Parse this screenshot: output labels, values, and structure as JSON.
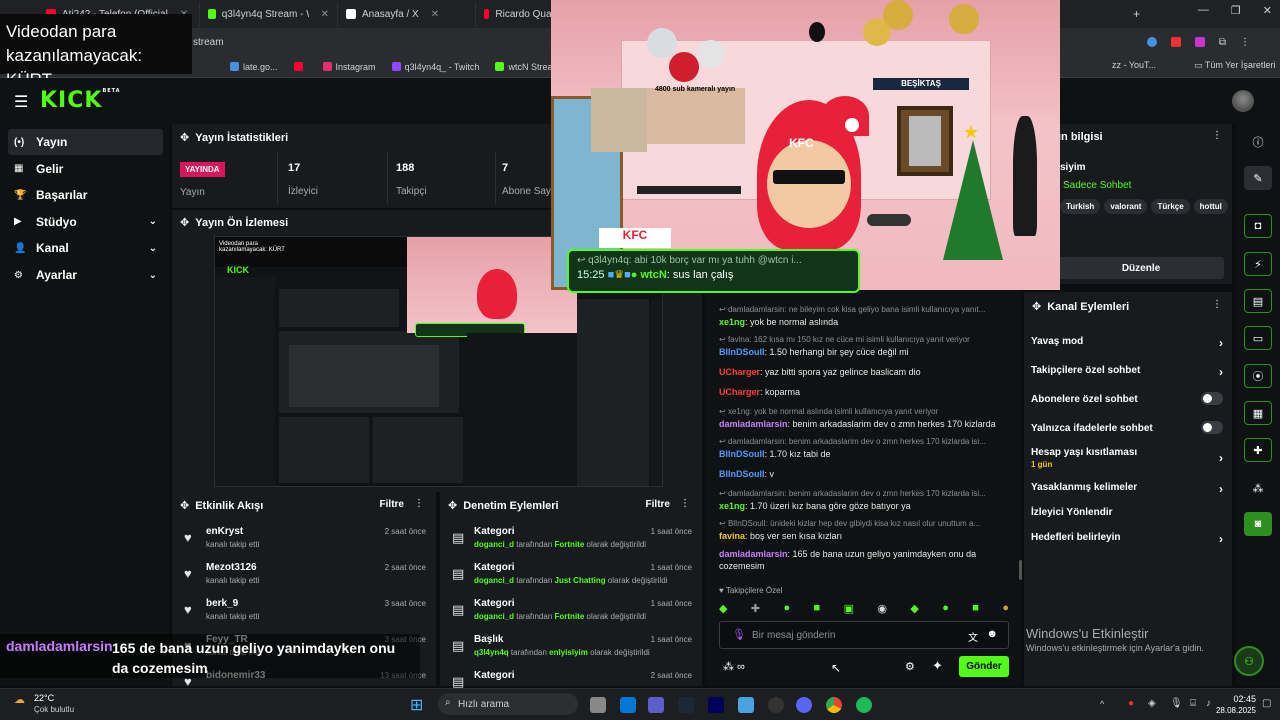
{
  "browser": {
    "tabs": [
      {
        "label": "Ati242 - Telefon (Official",
        "color": "#ff0033"
      },
      {
        "label": "q3l4yn4q Stream - Watch",
        "color": "#53fc18"
      },
      {
        "label": "Anasayfa / X",
        "color": "#ffffff"
      },
      {
        "label": "Ricardo Quaresma • Çing",
        "color": "#ff0033"
      }
    ],
    "address": "stream",
    "bookmarks": [
      {
        "label": "late.go...",
        "color": "#4a90e2"
      },
      {
        "label": "",
        "color": "#ff0033"
      },
      {
        "label": "Instagram",
        "color": "#e1306c"
      },
      {
        "label": "q3l4yn4q_ - Twitch",
        "color": "#9146ff"
      },
      {
        "label": "wtcN Stream - Watc...",
        "color": "#53fc18"
      },
      {
        "label": "Sana c",
        "color": "#ffffff"
      }
    ],
    "bookmarks_right": [
      "zz - YouT...",
      "Tüm Yer İşaretleri"
    ]
  },
  "overlay_title": {
    "line1": "Videodan para",
    "line2": "kazanılamayacak: KÜRT"
  },
  "header": {
    "logo": "KICK",
    "logo_sup": "BETA"
  },
  "nav": [
    {
      "label": "Yayın",
      "icon": "(•)",
      "chevron": false,
      "active": true
    },
    {
      "label": "Gelir",
      "icon": "▦",
      "chevron": false,
      "active": false
    },
    {
      "label": "Başarılar",
      "icon": "🏆",
      "chevron": false,
      "active": false
    },
    {
      "label": "Stüdyo",
      "icon": "▶",
      "chevron": true,
      "active": false
    },
    {
      "label": "Kanal",
      "icon": "👤",
      "chevron": true,
      "active": false
    },
    {
      "label": "Ayarlar",
      "icon": "⚙",
      "chevron": true,
      "active": false
    }
  ],
  "stats": {
    "title": "Yayın İstatistikleri",
    "live_badge": "YAYINDA",
    "live_label": "Yayın",
    "items": [
      {
        "value": "17",
        "label": "İzleyici"
      },
      {
        "value": "188",
        "label": "Takipçi"
      },
      {
        "value": "7",
        "label": "Abone Say"
      }
    ]
  },
  "preview": {
    "title": "Yayın Ön İzlemesi"
  },
  "activity": {
    "title": "Etkinlik Akışı",
    "filter": "Filtre",
    "items": [
      {
        "name": "enKryst",
        "sub": "kanalı takip etti",
        "time": "2 saat önce"
      },
      {
        "name": "Mezot3126",
        "sub": "kanalı takip etti",
        "time": "2 saat önce"
      },
      {
        "name": "berk_9",
        "sub": "kanalı takip etti",
        "time": "3 saat önce"
      },
      {
        "name": "Feyy_TR",
        "sub": "kanalı takip etti",
        "time": "3 saat önce"
      },
      {
        "name": "bidonemir33",
        "sub": "",
        "time": "13 saat önce"
      }
    ]
  },
  "modlog": {
    "title": "Denetim Eylemleri",
    "filter": "Filtre",
    "items": [
      {
        "name": "Kategori",
        "user": "doganci_d",
        "mid": " tarafından ",
        "value": "Fortnite",
        "end": " olarak değiştirildi",
        "time": "1 saat önce"
      },
      {
        "name": "Kategori",
        "user": "doganci_d",
        "mid": " tarafından ",
        "value": "Just Chatting",
        "end": " olarak değiştirildi",
        "time": "1 saat önce"
      },
      {
        "name": "Kategori",
        "user": "doganci_d",
        "mid": " tarafından ",
        "value": "Fortnite",
        "end": " olarak değiştirildi",
        "time": "1 saat önce"
      },
      {
        "name": "Başlık",
        "user": "q3l4yn4q",
        "mid": " tarafından ",
        "value": "enlyislyim",
        "end": " olarak değiştirildi",
        "time": "1 saat önce"
      },
      {
        "name": "Kategori",
        "user": "",
        "mid": "",
        "value": "",
        "end": "",
        "time": "2 saat önce"
      }
    ]
  },
  "chat": {
    "messages": [
      {
        "reply": "damladamlarsin: ne bileyim cok kisa geliyo bana isimli kullanıcıya yanıt...",
        "user": "xe1ng",
        "color": "#53fc18",
        "text": "yok be normal aslında"
      },
      {
        "reply": "favina: 162 kısa mı 150 kız ne cüce mi isimli kullanıcıya yanıt veriyor",
        "user": "BlInDSoulI",
        "color": "#4a9bff",
        "text": "1.50 herhangi bir şey cüce değil mi"
      },
      {
        "reply": "",
        "user": "UCharger",
        "color": "#ff3b3b",
        "text": "yaz bitti spora yaz gelince baslicam dio"
      },
      {
        "reply": "",
        "user": "UCharger",
        "color": "#ff3b3b",
        "text": "koparma"
      },
      {
        "reply": "xe1ng: yok be normal aslında isimli kullanıcıya yanıt veriyor",
        "user": "damladamlarsin",
        "color": "#c77dff",
        "text": "benim arkadaslarim dev o zmn herkes 170 kizlarda"
      },
      {
        "reply": "damladamlarsin: benim arkadaslarim dev o zmn herkes 170 kizlarda isi...",
        "user": "BlInDSoulI",
        "color": "#4a9bff",
        "text": "1.70 kız tabi de"
      },
      {
        "reply": "",
        "user": "BlInDSoulI",
        "color": "#4a9bff",
        "text": "v"
      },
      {
        "reply": "damladamlarsin: benim arkadaslarim dev o zmn herkes 170 kizlarda isi...",
        "user": "xe1ng",
        "color": "#53fc18",
        "text": "1.70 üzeri kız bana göre göze batıyor ya"
      },
      {
        "reply": "BlInDSoulI: ünideki kizlar hep dev gibiydi kisa kız nasıl olur unuttum a...",
        "user": "favina",
        "color": "#f0c419",
        "text": "boş ver sen kısa kızları"
      },
      {
        "reply": "",
        "user": "damladamlarsin",
        "color": "#c77dff",
        "text": "165 de bana uzun geliyo yanimdayken onu da cozemesim"
      }
    ],
    "followers_only": "Takipçilere Özel",
    "input_placeholder": "Bir mesaj gönderin",
    "send": "Gönder"
  },
  "channel_info": {
    "title": "Yayın bilgisi",
    "title_partial": "ın bilgisi",
    "subtitle": "siyim",
    "mode": "Sadece Sohbet",
    "tags": [
      "Turkish",
      "valorant",
      "Türkçe",
      "hottul"
    ],
    "edit": "Düzenle"
  },
  "channel_actions": {
    "title": "Kanal Eylemleri",
    "items": [
      {
        "label": "Yavaş mod",
        "kind": "chevron",
        "sub": ""
      },
      {
        "label": "Takipçilere özel sohbet",
        "kind": "chevron",
        "sub": ""
      },
      {
        "label": "Abonelere özel sohbet",
        "kind": "toggle",
        "sub": ""
      },
      {
        "label": "Yalnızca ifadelerle sohbet",
        "kind": "toggle",
        "sub": ""
      },
      {
        "label": "Hesap yaşı kısıtlaması",
        "kind": "chevron",
        "sub": "1 gün"
      },
      {
        "label": "Yasaklanmış kelimeler",
        "kind": "chevron",
        "sub": ""
      },
      {
        "label": "İzleyici Yönlendir",
        "kind": "none",
        "sub": ""
      },
      {
        "label": "Hedefleri belirleyin",
        "kind": "chevron",
        "sub": ""
      }
    ]
  },
  "stream_overlay": {
    "top_label": "4800 sub kameralı yayın",
    "banner": "BEŞİKTAŞ",
    "hat_text": "KFC",
    "box_text": "KFC",
    "chat_reply": "q3l4yn4q: abi 10k borç var mı ya tuhh @wtcn i...",
    "chat_time": "15:25",
    "chat_user": "wtcN",
    "chat_text": "sus lan çalış"
  },
  "caption": {
    "user": "damladamlarsin",
    "text": "165 de bana uzun geliyo yanimdayken onu da cozemesim"
  },
  "windows": {
    "activate_title": "Windows'u Etkinleştir",
    "activate_sub": "Windows'u etkinleştirmek için Ayarlar'a gidin.",
    "weather_temp": "22°C",
    "weather_desc": "Çok bulutlu",
    "search": "Hızlı arama",
    "time": "02:45",
    "date": "28.08.2025"
  }
}
